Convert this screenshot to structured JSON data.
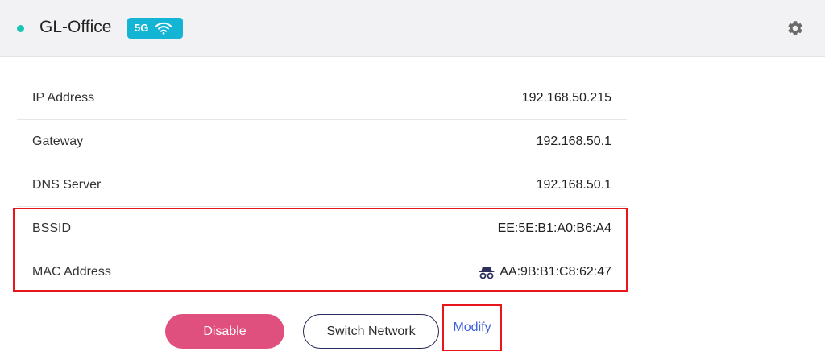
{
  "header": {
    "network_name": "GL-Office",
    "band_label": "5G",
    "status_color": "#19c6b4",
    "badge_color": "#14b4d4",
    "icons": [
      "status-dot",
      "wifi-icon",
      "gear-icon"
    ]
  },
  "info": {
    "rows": [
      {
        "label": "IP Address",
        "value": "192.168.50.215"
      },
      {
        "label": "Gateway",
        "value": "192.168.50.1"
      },
      {
        "label": "DNS Server",
        "value": "192.168.50.1"
      },
      {
        "label": "BSSID",
        "value": "EE:5E:B1:A0:B6:A4"
      },
      {
        "label": "MAC Address",
        "value": "AA:9B:B1:C8:62:47",
        "icon": "incognito-spy-icon"
      }
    ]
  },
  "actions": {
    "disable_label": "Disable",
    "switch_label": "Switch Network",
    "modify_label": "Modify",
    "disable_color": "#e0507f",
    "modify_color": "#3f63d8"
  },
  "annotations": {
    "highlight_color": "#e8161c"
  }
}
